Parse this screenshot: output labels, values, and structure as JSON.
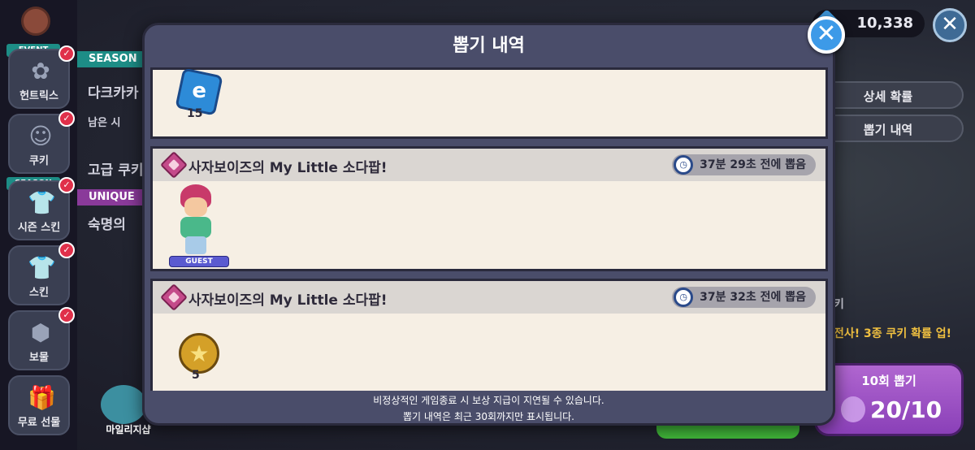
{
  "currencies": {
    "crystal": "10,338"
  },
  "left_rail": {
    "items": [
      {
        "label": "헌트릭스",
        "tag": "EVENT",
        "icon": "pretzel-icon"
      },
      {
        "label": "쿠키",
        "icon": "cookie-face-icon"
      },
      {
        "label": "시즌 스킨",
        "tag": "SEASON",
        "icon": "shirt-clock-icon"
      },
      {
        "label": "스킨",
        "icon": "shirt-icon"
      },
      {
        "label": "보물",
        "icon": "treasure-hexagon-icon"
      },
      {
        "label": "무료 선물",
        "icon": "gift-icon"
      }
    ]
  },
  "side_panel": {
    "season_tag": "SEASON",
    "season_text": "다크카카",
    "remaining": "남은 시",
    "premium": "고급 쿠키",
    "unique_tag": "UNIQUE",
    "unique_text": "숙명의"
  },
  "mileage_shop": {
    "label": "마일리지샵"
  },
  "right_panel": {
    "detail_rates": "상세 확률",
    "draw_history": "뽑기 내역",
    "bg_label": "키",
    "promo": "전사! 3종 쿠키 확률 업!",
    "draw10": {
      "label": "10회 뽑기",
      "count": "20/10"
    }
  },
  "modal": {
    "title": "뽑기 내역",
    "entries": [
      {
        "items": [
          {
            "qty": "15",
            "icon": "soulstone-blue-icon"
          }
        ]
      },
      {
        "name": "사자보이즈의 My Little 소다팝!",
        "time": "37분 29초 전에 뽑음",
        "items": [
          {
            "guest_badge": "GUEST",
            "icon": "cookie-character-icon"
          }
        ]
      },
      {
        "name": "사자보이즈의 My Little 소다팝!",
        "time": "37분 32초 전에 뽑음",
        "items": [
          {
            "qty": "5",
            "icon": "soulstone-gold-icon"
          }
        ]
      }
    ],
    "footer": [
      "비정상적인 게임종료 시 보상 지급이 지연될 수 있습니다.",
      "뽑기 내역은 최근 30회까지만 표시됩니다."
    ]
  },
  "colors": {
    "modal_bg": "#4a4d6a",
    "entry_bg": "#f6efe4",
    "close_btn": "#3d9ae8",
    "draw10_btn": "#a055c6"
  }
}
